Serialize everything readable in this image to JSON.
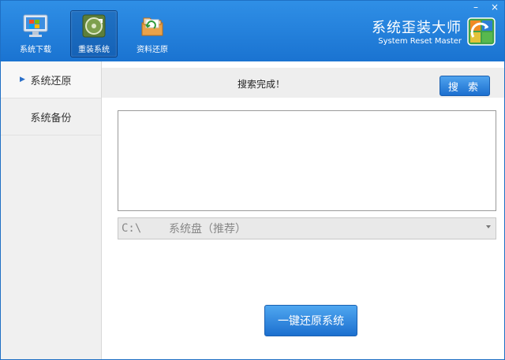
{
  "window": {
    "controls": [
      "–",
      "×"
    ]
  },
  "toolbar": {
    "items": [
      {
        "label": "系统下载",
        "icon": "monitor-windows-icon",
        "active": false
      },
      {
        "label": "重装系统",
        "icon": "recycle-disk-icon",
        "active": true
      },
      {
        "label": "资料还原",
        "icon": "folder-restore-icon",
        "active": false
      }
    ]
  },
  "brand": {
    "title": "系统歪装大师",
    "subtitle": "System Reset Master",
    "icon": "brand-logo-icon"
  },
  "sidebar": {
    "items": [
      {
        "label": "系统还原",
        "active": true
      },
      {
        "label": "系统备份",
        "active": false
      }
    ]
  },
  "main": {
    "status": "搜索完成！",
    "search_label": "搜 索",
    "drive": {
      "letter": "C:\\",
      "label": "系统盘（推荐）"
    },
    "restore_label": "一键还原系统"
  },
  "colors": {
    "header": "#1f7ddb",
    "button": "#2f86e0",
    "sidebar": "#f0f0f0"
  }
}
